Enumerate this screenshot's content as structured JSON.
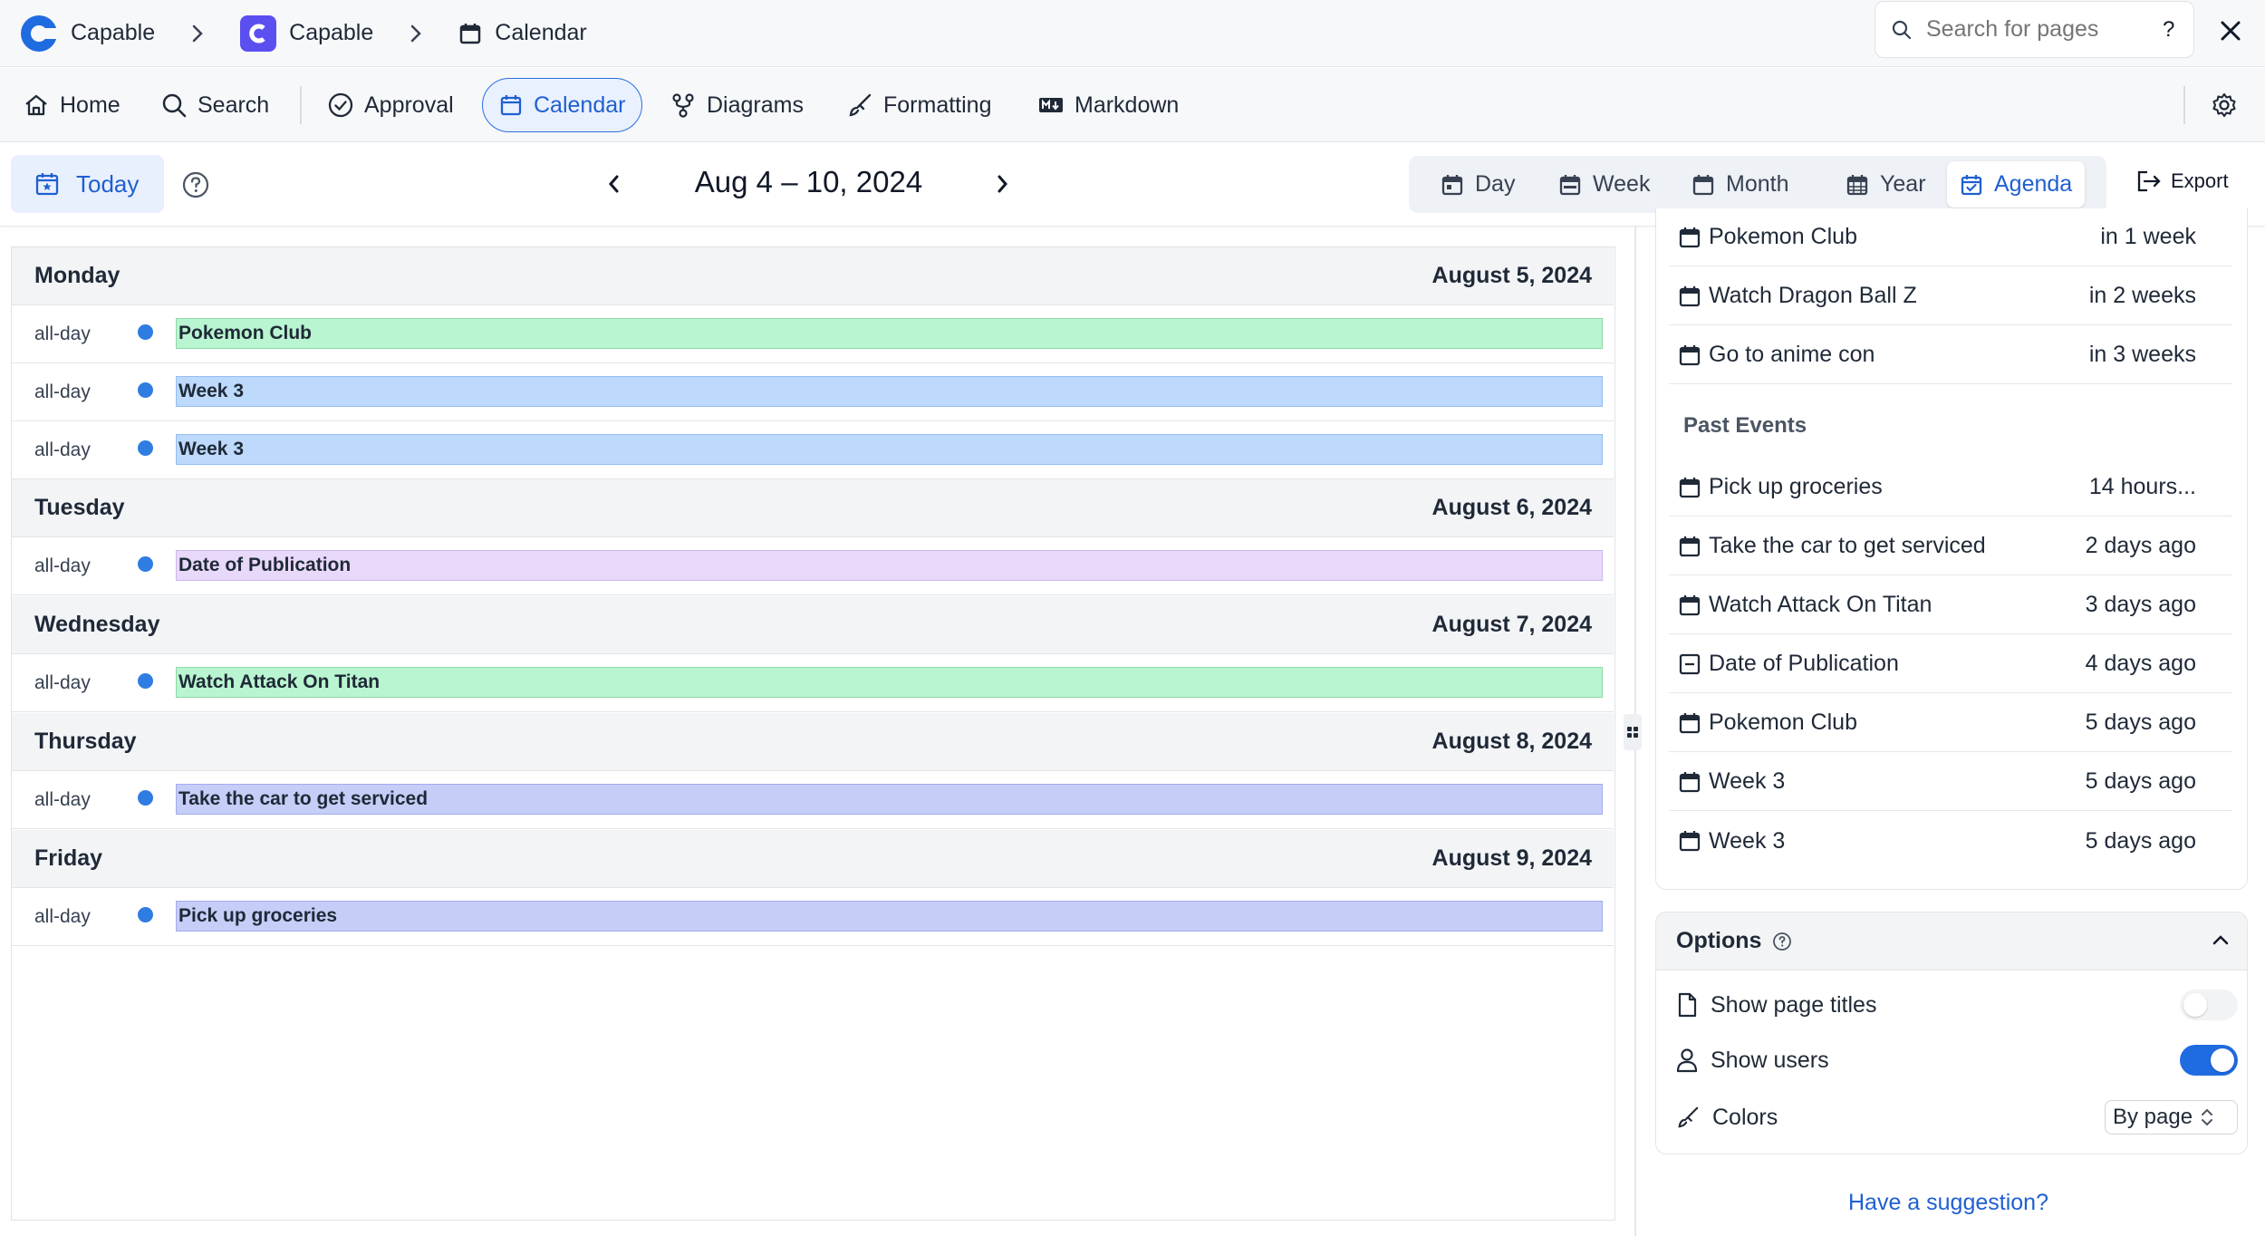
{
  "breadcrumb": [
    {
      "label": "Capable"
    },
    {
      "label": "Capable"
    },
    {
      "label": "Calendar"
    }
  ],
  "search": {
    "placeholder": "Search for pages",
    "help": "?"
  },
  "nav": {
    "home": "Home",
    "search": "Search",
    "approval": "Approval",
    "calendar": "Calendar",
    "diagrams": "Diagrams",
    "formatting": "Formatting",
    "markdown": "Markdown"
  },
  "toolbar": {
    "today": "Today",
    "range": "Aug 4 – 10, 2024",
    "views": [
      "Day",
      "Week",
      "Month",
      "Year",
      "Agenda"
    ],
    "active_view": "Agenda",
    "export": "Export"
  },
  "agenda": {
    "allday_label": "all-day",
    "days": [
      {
        "name": "Monday",
        "date": "August 5, 2024"
      },
      {
        "name": "Tuesday",
        "date": "August 6, 2024"
      },
      {
        "name": "Wednesday",
        "date": "August 7, 2024"
      },
      {
        "name": "Thursday",
        "date": "August 8, 2024"
      },
      {
        "name": "Friday",
        "date": "August 9, 2024"
      }
    ],
    "events": [
      {
        "title": "Pokemon Club",
        "color": "#b9f5d0",
        "border": "#8fd9a8"
      },
      {
        "title": "Week 3",
        "color": "#bdd9fb",
        "border": "#94bdf2"
      },
      {
        "title": "Week 3",
        "color": "#bdd9fb",
        "border": "#94bdf2"
      },
      {
        "title": "Date of Publication",
        "color": "#e8d9fb",
        "border": "#cdb6f0"
      },
      {
        "title": "Watch Attack On Titan",
        "color": "#b9f5d0",
        "border": "#8fd9a8"
      },
      {
        "title": "Take the car to get serviced",
        "color": "#c6cdf7",
        "border": "#a3adef"
      },
      {
        "title": "Pick up groceries",
        "color": "#c6cdf7",
        "border": "#a3adef"
      }
    ],
    "dot_color": "#2f7de1"
  },
  "sidebar": {
    "upcoming": [
      {
        "title": "Pokemon Club",
        "when": "in 1 week"
      },
      {
        "title": "Watch Dragon Ball Z",
        "when": "in 2 weeks"
      },
      {
        "title": "Go to anime con",
        "when": "in 3 weeks"
      }
    ],
    "past_label": "Past Events",
    "past": [
      {
        "title": "Pick up groceries",
        "when": "14 hours..."
      },
      {
        "title": "Take the car to get serviced",
        "when": "2 days ago"
      },
      {
        "title": "Watch Attack On Titan",
        "when": "3 days ago"
      },
      {
        "title": "Date of Publication",
        "when": "4 days ago",
        "icon": "minus-page-icon"
      },
      {
        "title": "Pokemon Club",
        "when": "5 days ago"
      },
      {
        "title": "Week 3",
        "when": "5 days ago"
      },
      {
        "title": "Week 3",
        "when": "5 days ago"
      }
    ],
    "options": {
      "title": "Options",
      "show_page_titles": "Show page titles",
      "show_page_titles_on": false,
      "show_users": "Show users",
      "show_users_on": true,
      "colors": "Colors",
      "colors_value": "By page"
    },
    "suggestion": "Have a suggestion?"
  },
  "colors": {
    "accent": "#1f5fd1",
    "brand": "#5b4ff0"
  }
}
